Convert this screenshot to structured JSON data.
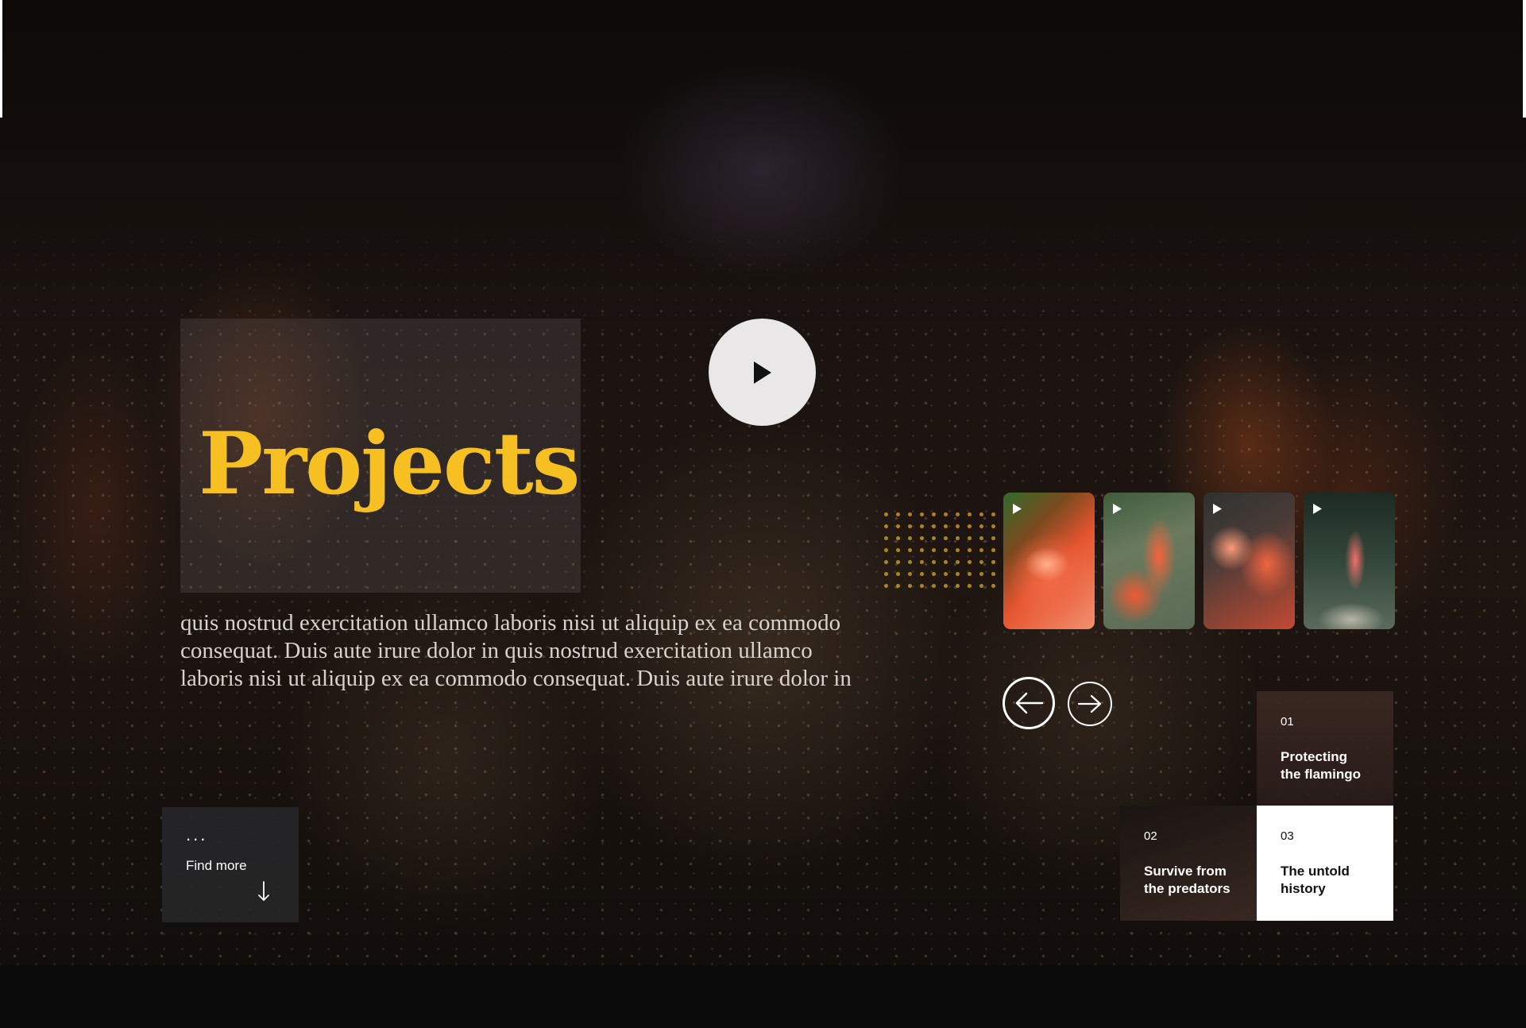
{
  "hero": {
    "title": "Projects",
    "description": "quis nostrud exercitation ullamco laboris nisi ut aliquip ex ea commodo consequat. Duis aute irure dolor in quis nostrud exercitation ullamco laboris nisi ut aliquip ex ea commodo consequat. Duis aute irure dolor in",
    "accent_color": "#f6bf22",
    "play_icon": "play-icon"
  },
  "thumbnails": [
    {
      "subject": "flamingo head close-up",
      "icon": "play-icon"
    },
    {
      "subject": "flamingo neck curve",
      "icon": "play-icon"
    },
    {
      "subject": "two flamingos",
      "icon": "play-icon"
    },
    {
      "subject": "flamingos by water",
      "icon": "play-icon"
    }
  ],
  "navigation": {
    "prev_icon": "arrow-left-icon",
    "next_icon": "arrow-right-icon"
  },
  "stories": [
    {
      "number": "01",
      "title": "Protecting the flamingo"
    },
    {
      "number": "02",
      "title": "Survive from the predators"
    },
    {
      "number": "03",
      "title": "The untold history"
    }
  ],
  "find_more": {
    "dots": "...",
    "label": "Find more",
    "icon": "arrow-down-icon"
  }
}
